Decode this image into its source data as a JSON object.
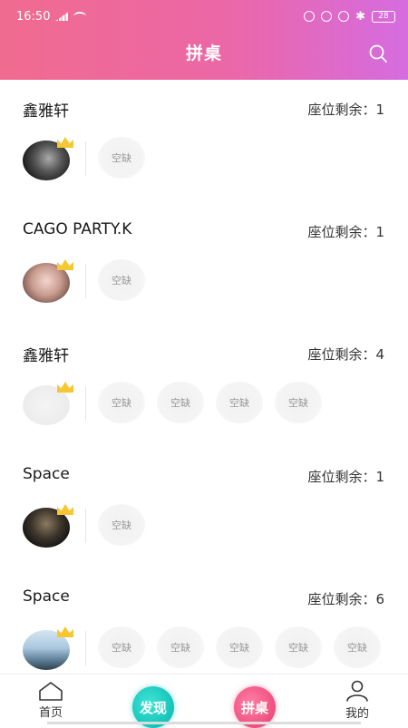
{
  "status_bar": {
    "time": "16:50",
    "battery": "28"
  },
  "header": {
    "title": "拼桌",
    "search_icon": "search-icon"
  },
  "tables": [
    {
      "name": "鑫雅轩",
      "seats_label": "座位剩余：",
      "seats_remaining": "1",
      "empty_seats": [
        "空缺"
      ]
    },
    {
      "name": "CAGO PARTY.K",
      "seats_label": "座位剩余：",
      "seats_remaining": "1",
      "empty_seats": [
        "空缺"
      ]
    },
    {
      "name": "鑫雅轩",
      "seats_label": "座位剩余：",
      "seats_remaining": "4",
      "empty_seats": [
        "空缺",
        "空缺",
        "空缺",
        "空缺"
      ]
    },
    {
      "name": "Space",
      "seats_label": "座位剩余：",
      "seats_remaining": "1",
      "empty_seats": [
        "空缺"
      ]
    },
    {
      "name": "Space",
      "seats_label": "座位剩余：",
      "seats_remaining": "6",
      "empty_seats": [
        "空缺",
        "空缺",
        "空缺",
        "空缺",
        "空缺"
      ]
    }
  ],
  "tabbar": {
    "home": "首页",
    "discover": "发现",
    "table": "拼桌",
    "mine": "我的"
  },
  "colors": {
    "header_start": "#f06b8f",
    "header_end": "#d56ce0",
    "discover_accent": "#15c3b8",
    "table_accent": "#ef4f7f"
  }
}
